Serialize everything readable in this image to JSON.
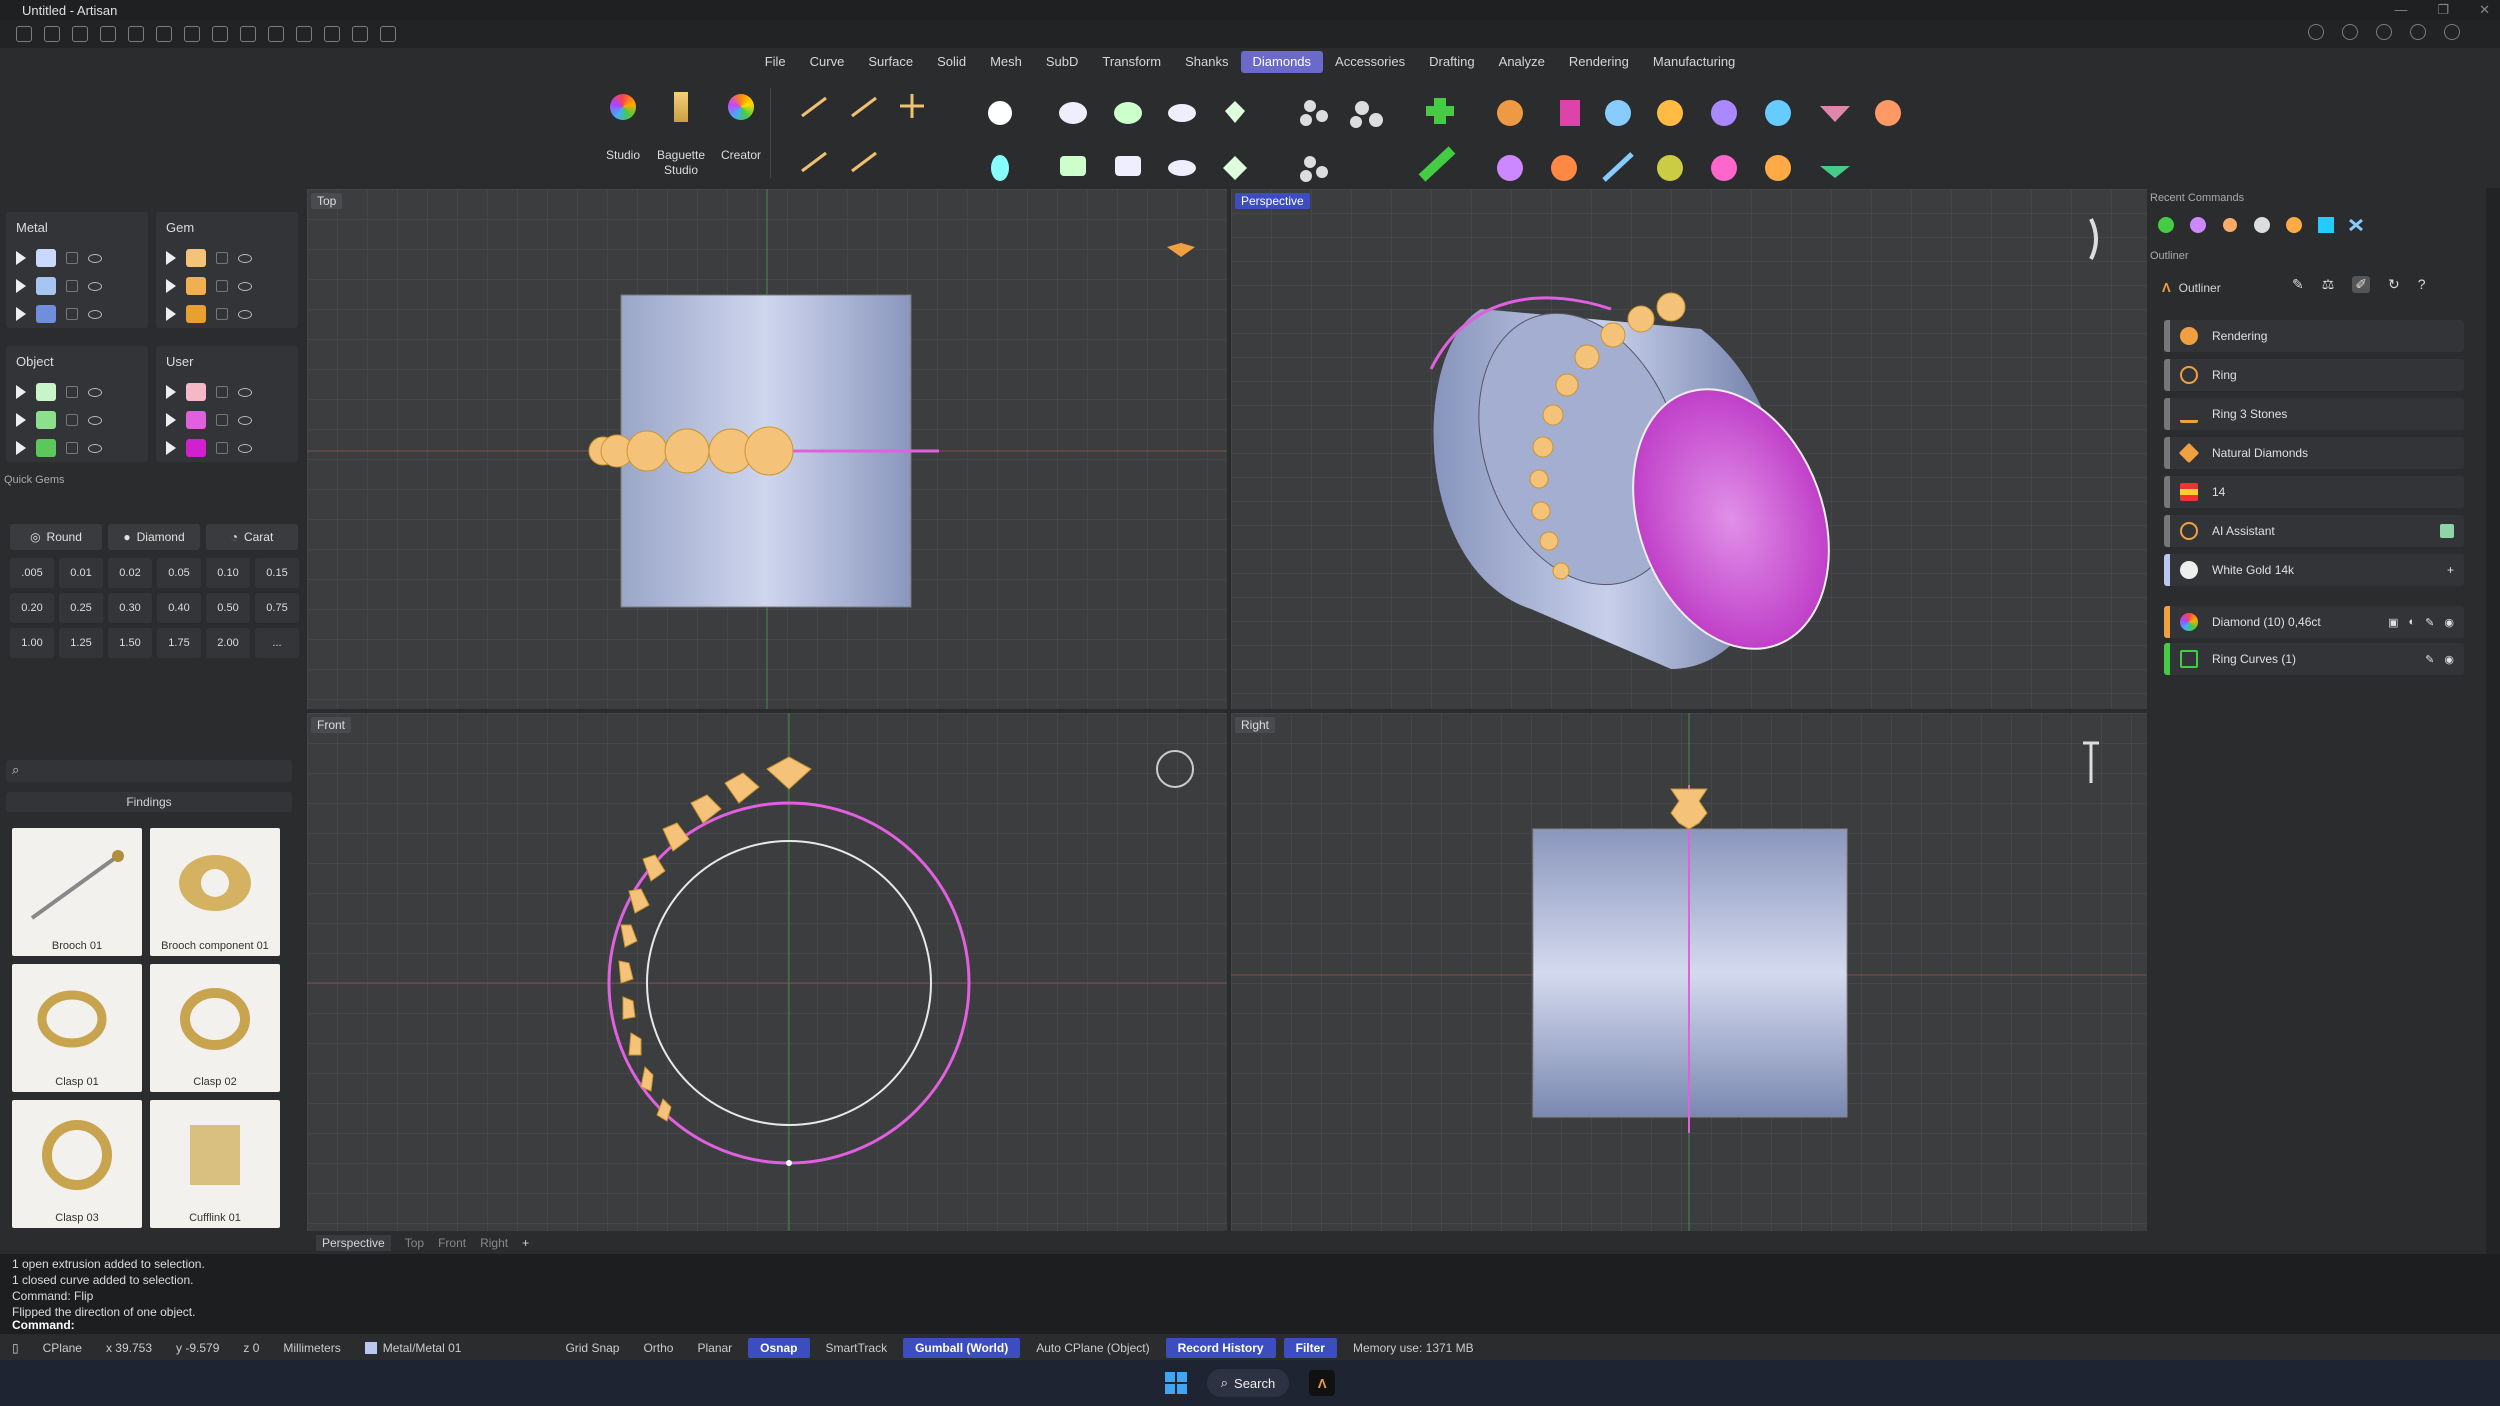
{
  "window": {
    "title": "Untitled - Artisan"
  },
  "menu": [
    "File",
    "Curve",
    "Surface",
    "Solid",
    "Mesh",
    "SubD",
    "Transform",
    "Shanks",
    "Diamonds",
    "Accessories",
    "Drafting",
    "Analyze",
    "Rendering",
    "Manufacturing"
  ],
  "menu_active": "Diamonds",
  "ribbon": {
    "studio": "Studio",
    "baguette_l1": "Baguette",
    "baguette_l2": "Studio",
    "creator": "Creator"
  },
  "layers": {
    "metal": {
      "title": "Metal",
      "colors": [
        "#c8d8ff",
        "#a8c4f0",
        "#6f8fdc"
      ]
    },
    "gem": {
      "title": "Gem",
      "colors": [
        "#f5c27a",
        "#f0b050",
        "#e8a030"
      ]
    },
    "object": {
      "title": "Object",
      "colors": [
        "#c8f5c8",
        "#8ce08c",
        "#5cc85c"
      ]
    },
    "user": {
      "title": "User",
      "colors": [
        "#f5b8c8",
        "#e060e0",
        "#d020d0"
      ]
    }
  },
  "quick_gems": {
    "title": "Quick Gems",
    "shape": "Round",
    "material": "Diamond",
    "unit": "Carat",
    "carats": [
      ".005",
      "0.01",
      "0.02",
      "0.05",
      "0.10",
      "0.15",
      "0.20",
      "0.25",
      "0.30",
      "0.40",
      "0.50",
      "0.75",
      "1.00",
      "1.25",
      "1.50",
      "1.75",
      "2.00",
      "..."
    ]
  },
  "library": {
    "search_placeholder": "",
    "category": "Findings",
    "items": [
      "Brooch 01",
      "Brooch component 01",
      "Clasp 01",
      "Clasp 02",
      "Clasp 03",
      "Cufflink 01"
    ]
  },
  "viewports": {
    "top": "Top",
    "perspective": "Perspective",
    "front": "Front",
    "right": "Right"
  },
  "vp_tabs": [
    "Perspective",
    "Top",
    "Front",
    "Right"
  ],
  "recent_commands_title": "Recent Commands",
  "outliner": {
    "section": "Outliner",
    "title": "Outliner",
    "rows": [
      "Rendering",
      "Ring",
      "Ring 3 Stones",
      "Natural Diamonds",
      "14",
      "AI Assistant",
      "White Gold 14k"
    ],
    "objects": [
      "Diamond (10) 0,46ct",
      "Ring Curves (1)"
    ]
  },
  "command_history": [
    "1 open extrusion added to selection.",
    "1 closed curve added to selection.",
    "Command: Flip",
    "Flipped the direction of one object."
  ],
  "command_prompt": "Command:",
  "status": {
    "cplane": "CPlane",
    "x": "x 39.753",
    "y": "y -9.579",
    "z": "z 0",
    "units": "Millimeters",
    "layer": "Metal/Metal 01",
    "grid_snap": "Grid Snap",
    "ortho": "Ortho",
    "planar": "Planar",
    "osnap": "Osnap",
    "smarttrack": "SmartTrack",
    "gumball": "Gumball (World)",
    "auto_cplane": "Auto CPlane (Object)",
    "record_history": "Record History",
    "filter": "Filter",
    "memory": "Memory use: 1371 MB"
  },
  "taskbar": {
    "search": "Search"
  },
  "colors": {
    "accent": "#6b6acb",
    "active_blue": "#3b4dbf",
    "gem": "#f5c27a",
    "curve": "#e060e0",
    "metal": "#b8c4e4"
  }
}
